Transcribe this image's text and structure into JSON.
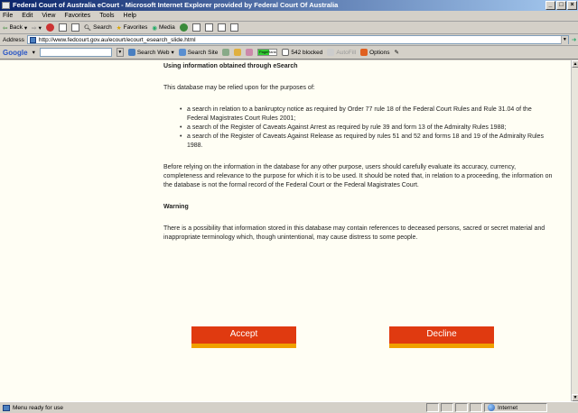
{
  "window": {
    "title": "Federal Court of Australia eCourt - Microsoft Internet Explorer provided by Federal Court Of Australia"
  },
  "menu": [
    "File",
    "Edit",
    "View",
    "Favorites",
    "Tools",
    "Help"
  ],
  "toolbar": {
    "back": "Back",
    "search": "Search",
    "favorites": "Favorites",
    "media": "Media"
  },
  "address": {
    "label": "Address",
    "url": "http://www.fedcourt.gov.au/ecourt/ecourt_esearch_slide.html"
  },
  "googlebar": {
    "logo": "Google",
    "search_web": "Search Web",
    "search_site": "Search Site",
    "pagerank": "PageRank",
    "blocked": "542 blocked",
    "autofill": "AutoFill",
    "options": "Options"
  },
  "page": {
    "heading": "Using information obtained through eSearch",
    "intro": "This database may be relied upon for the purposes of:",
    "bullets": [
      "a search in relation to a bankruptcy notice as required by Order 77 rule 18 of the Federal Court Rules and Rule 31.04 of the Federal Magistrates Court Rules 2001;",
      "a search of the Register of Caveats Against Arrest as required by rule 39 and form 13 of the Admiralty Rules 1988;",
      "a search of the Register of Caveats Against Release as required by rules 51 and 52 and forms 18 and 19 of the Admiralty Rules 1988."
    ],
    "caution": "Before relying on the information in the database for any other purpose, users should carefully evaluate its accuracy, currency, completeness and relevance to the purpose for which it is to be used. It should be noted that, in relation to a proceeding, the information on the database is not the formal record of the Federal Court or the Federal Magistrates Court.",
    "warning_heading": "Warning",
    "warning_text": "There is a possibility that information stored in this database may contain references to deceased persons, sacred or secret material and inappropriate terminology which, though unintentional, may cause distress to some people.",
    "accept_label": "Accept",
    "decline_label": "Decline"
  },
  "status": {
    "text": "Menu ready for use",
    "zone": "Internet"
  }
}
